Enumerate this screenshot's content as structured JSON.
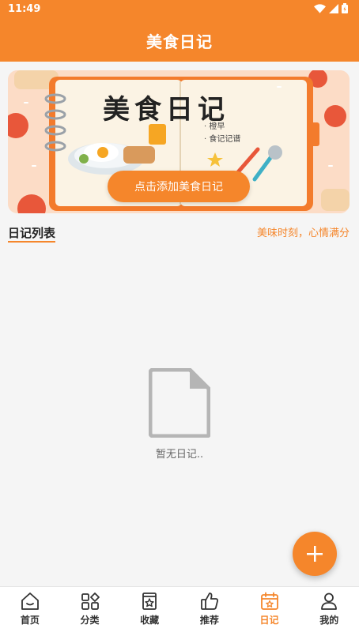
{
  "status_bar": {
    "time": "11:49"
  },
  "app_bar": {
    "title": "美食日记"
  },
  "banner": {
    "image_title": "美食日记",
    "note_line1": "· 橙早",
    "note_line2": "· 食记记谱",
    "button_label": "点击添加美食日记"
  },
  "list": {
    "title": "日记列表",
    "slogan": "美味时刻，心情满分"
  },
  "empty": {
    "text": "暂无日记.."
  },
  "fab": {
    "icon": "plus-icon"
  },
  "nav": {
    "items": [
      {
        "label": "首页",
        "icon": "home-icon"
      },
      {
        "label": "分类",
        "icon": "category-icon"
      },
      {
        "label": "收藏",
        "icon": "favorites-icon"
      },
      {
        "label": "推荐",
        "icon": "thumbs-up-icon"
      },
      {
        "label": "日记",
        "icon": "calendar-icon",
        "active": true
      },
      {
        "label": "我的",
        "icon": "person-icon"
      }
    ]
  },
  "colors": {
    "accent": "#f5862b",
    "background": "#f5f5f5"
  }
}
